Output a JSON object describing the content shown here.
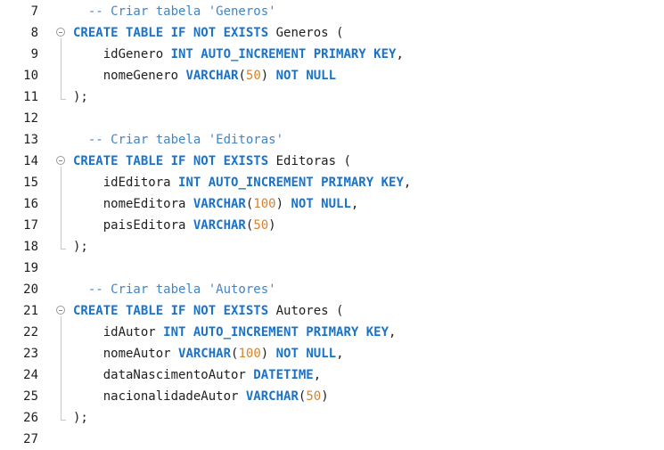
{
  "colors": {
    "keyword": "#1a72c9",
    "comment": "#3f86c9",
    "number": "#d9822b",
    "text": "#1e1e1e"
  },
  "lines": [
    {
      "n": "7",
      "fold": false,
      "tokens": [
        {
          "t": "  -- Criar tabela 'Generos'",
          "c": "cm"
        }
      ]
    },
    {
      "n": "8",
      "fold": true,
      "tokens": [
        {
          "t": "CREATE TABLE IF NOT EXISTS",
          "c": "kw"
        },
        {
          "t": " Generos (",
          "c": "id"
        }
      ]
    },
    {
      "n": "9",
      "fold": false,
      "tokens": [
        {
          "t": "    idGenero ",
          "c": "id"
        },
        {
          "t": "INT AUTO_INCREMENT PRIMARY KEY",
          "c": "kw"
        },
        {
          "t": ",",
          "c": "pn"
        }
      ]
    },
    {
      "n": "10",
      "fold": false,
      "tokens": [
        {
          "t": "    nomeGenero ",
          "c": "id"
        },
        {
          "t": "VARCHAR",
          "c": "kw"
        },
        {
          "t": "(",
          "c": "pn"
        },
        {
          "t": "50",
          "c": "num"
        },
        {
          "t": ") ",
          "c": "pn"
        },
        {
          "t": "NOT NULL",
          "c": "kw"
        }
      ]
    },
    {
      "n": "11",
      "fold": false,
      "tokens": [
        {
          "t": ");",
          "c": "pn"
        }
      ]
    },
    {
      "n": "12",
      "fold": false,
      "tokens": []
    },
    {
      "n": "13",
      "fold": false,
      "tokens": [
        {
          "t": "  -- Criar tabela 'Editoras'",
          "c": "cm"
        }
      ]
    },
    {
      "n": "14",
      "fold": true,
      "tokens": [
        {
          "t": "CREATE TABLE IF NOT EXISTS",
          "c": "kw"
        },
        {
          "t": " Editoras (",
          "c": "id"
        }
      ]
    },
    {
      "n": "15",
      "fold": false,
      "tokens": [
        {
          "t": "    idEditora ",
          "c": "id"
        },
        {
          "t": "INT AUTO_INCREMENT PRIMARY KEY",
          "c": "kw"
        },
        {
          "t": ",",
          "c": "pn"
        }
      ]
    },
    {
      "n": "16",
      "fold": false,
      "tokens": [
        {
          "t": "    nomeEditora ",
          "c": "id"
        },
        {
          "t": "VARCHAR",
          "c": "kw"
        },
        {
          "t": "(",
          "c": "pn"
        },
        {
          "t": "100",
          "c": "num"
        },
        {
          "t": ") ",
          "c": "pn"
        },
        {
          "t": "NOT NULL",
          "c": "kw"
        },
        {
          "t": ",",
          "c": "pn"
        }
      ]
    },
    {
      "n": "17",
      "fold": false,
      "tokens": [
        {
          "t": "    paisEditora ",
          "c": "id"
        },
        {
          "t": "VARCHAR",
          "c": "kw"
        },
        {
          "t": "(",
          "c": "pn"
        },
        {
          "t": "50",
          "c": "num"
        },
        {
          "t": ")",
          "c": "pn"
        }
      ]
    },
    {
      "n": "18",
      "fold": false,
      "tokens": [
        {
          "t": ");",
          "c": "pn"
        }
      ]
    },
    {
      "n": "19",
      "fold": false,
      "tokens": []
    },
    {
      "n": "20",
      "fold": false,
      "tokens": [
        {
          "t": "  -- Criar tabela 'Autores'",
          "c": "cm"
        }
      ]
    },
    {
      "n": "21",
      "fold": true,
      "tokens": [
        {
          "t": "CREATE TABLE IF NOT EXISTS",
          "c": "kw"
        },
        {
          "t": " Autores (",
          "c": "id"
        }
      ]
    },
    {
      "n": "22",
      "fold": false,
      "tokens": [
        {
          "t": "    idAutor ",
          "c": "id"
        },
        {
          "t": "INT AUTO_INCREMENT PRIMARY KEY",
          "c": "kw"
        },
        {
          "t": ",",
          "c": "pn"
        }
      ]
    },
    {
      "n": "23",
      "fold": false,
      "tokens": [
        {
          "t": "    nomeAutor ",
          "c": "id"
        },
        {
          "t": "VARCHAR",
          "c": "kw"
        },
        {
          "t": "(",
          "c": "pn"
        },
        {
          "t": "100",
          "c": "num"
        },
        {
          "t": ") ",
          "c": "pn"
        },
        {
          "t": "NOT NULL",
          "c": "kw"
        },
        {
          "t": ",",
          "c": "pn"
        }
      ]
    },
    {
      "n": "24",
      "fold": false,
      "tokens": [
        {
          "t": "    dataNascimentoAutor ",
          "c": "id"
        },
        {
          "t": "DATETIME",
          "c": "kw"
        },
        {
          "t": ",",
          "c": "pn"
        }
      ]
    },
    {
      "n": "25",
      "fold": false,
      "tokens": [
        {
          "t": "    nacionalidadeAutor ",
          "c": "id"
        },
        {
          "t": "VARCHAR",
          "c": "kw"
        },
        {
          "t": "(",
          "c": "pn"
        },
        {
          "t": "50",
          "c": "num"
        },
        {
          "t": ")",
          "c": "pn"
        }
      ]
    },
    {
      "n": "26",
      "fold": false,
      "tokens": [
        {
          "t": ");",
          "c": "pn"
        }
      ]
    },
    {
      "n": "27",
      "fold": false,
      "tokens": []
    }
  ]
}
